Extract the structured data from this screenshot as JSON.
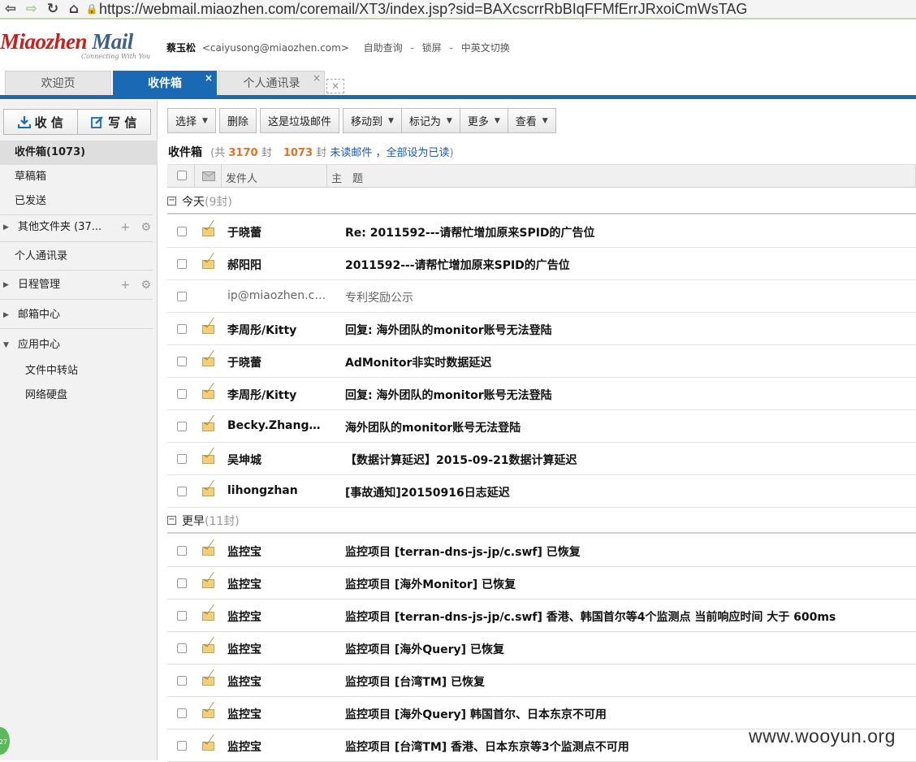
{
  "browser": {
    "url_host": "https://webmail.miaozhen.com",
    "url_path": "/coremail/XT3/index.jsp?sid=BAXcscrrRbBIqFFMfErrJRxoiCmWsTAG"
  },
  "logo": {
    "part1": "Miaozhen ",
    "part2": "Mail",
    "tagline": "Connecting With You"
  },
  "user": {
    "name": "蔡玉松",
    "email": "<caiyusong@miaozhen.com>",
    "links": [
      "自助查询",
      "锁屏",
      "中英文切换"
    ],
    "separator": "-"
  },
  "tabs": [
    {
      "label": "欢迎页"
    },
    {
      "label": "收件箱",
      "close": "×"
    },
    {
      "label": "个人通讯录",
      "close": "×"
    }
  ],
  "tabs_closeall": "✕",
  "compose": {
    "receive": "收 信",
    "write": "写 信"
  },
  "sidebar": {
    "inbox": "收件箱(1073)",
    "drafts": "草稿箱",
    "sent": "已发送",
    "other": "其他文件夹 (37...",
    "contacts": "个人通讯录",
    "calendar": "日程管理",
    "mailcenter": "邮箱中心",
    "appcenter": "应用中心",
    "transfer": "文件中转站",
    "netdisk": "网络硬盘",
    "plus": "+",
    "gear": "⚙"
  },
  "toolbar": {
    "select": "选择",
    "delete": "删除",
    "spam": "这是垃圾邮件",
    "move": "移动到",
    "mark": "标记为",
    "more": "更多",
    "view": "查看"
  },
  "folder": {
    "title": "收件箱",
    "count_prefix": "(共",
    "total": "3170",
    "count_unit": "封",
    "unread": "1073",
    "unread_unit": "封",
    "unread_label": "未读邮件",
    "mark_all": "，全部设为已读",
    "close": ")"
  },
  "list_head": {
    "from": "发件人",
    "subject": "主　题"
  },
  "groups": [
    {
      "label": "今天",
      "count": "(9封)"
    },
    {
      "label": "更早",
      "count": "(11封)"
    }
  ],
  "rows": [
    {
      "from": "于晓蕾",
      "subject": "Re: 2011592---请帮忙增加原来SPID的广告位"
    },
    {
      "from": "郝阳阳",
      "subject": "2011592---请帮忙增加原来SPID的广告位"
    },
    {
      "from": "ip@miaozhen.com",
      "subject": "专利奖励公示"
    },
    {
      "from": "李周彤/Kitty",
      "subject": "回复: 海外团队的monitor账号无法登陆"
    },
    {
      "from": "于晓蕾",
      "subject": "AdMonitor非实时数据延迟"
    },
    {
      "from": "李周彤/Kitty",
      "subject": "回复: 海外团队的monitor账号无法登陆"
    },
    {
      "from": "Becky.Zhang@...",
      "subject": "海外团队的monitor账号无法登陆"
    },
    {
      "from": "吴坤城",
      "subject": "【数据计算延迟】2015-09-21数据计算延迟"
    },
    {
      "from": "lihongzhan",
      "subject": "[事故通知]20150916日志延迟"
    },
    {
      "from": "监控宝",
      "subject": "监控项目 [terran-dns-js-jp/c.swf] 已恢复"
    },
    {
      "from": "监控宝",
      "subject": "监控项目 [海外Monitor] 已恢复"
    },
    {
      "from": "监控宝",
      "subject": "监控项目 [terran-dns-js-jp/c.swf] 香港、韩国首尔等4个监测点 当前响应时间 大于 600ms"
    },
    {
      "from": "监控宝",
      "subject": "监控项目 [海外Query] 已恢复"
    },
    {
      "from": "监控宝",
      "subject": "监控项目 [台湾TM] 已恢复"
    },
    {
      "from": "监控宝",
      "subject": "监控项目 [海外Query] 韩国首尔、日本东京不可用"
    },
    {
      "from": "监控宝",
      "subject": "监控项目 [台湾TM] 香港、日本东京等3个监测点不可用"
    }
  ],
  "watermark": "www.wooyun.org",
  "badge": "27",
  "colors": {
    "accent": "#1a69b5",
    "unread_count": "#e37222",
    "link": "#1a5aa8",
    "logo_red": "#c8201d"
  }
}
